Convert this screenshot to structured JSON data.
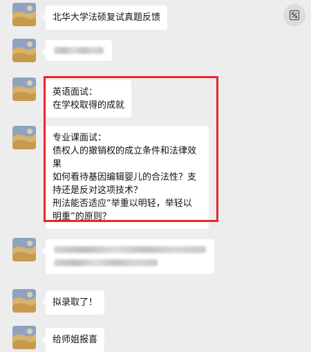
{
  "messages": {
    "m1": "北华大学法硕复试真题反馈",
    "m3": {
      "line1": "英语面试：",
      "line2": "在学校取得的成就"
    },
    "m4": {
      "line1": "专业课面试：",
      "line2": "债权人的撤销权的成立条件和法律效",
      "line3": "果",
      "line4": "如何看待基因编辑婴儿的合法性？支",
      "line5": "持还是反对这项技术？",
      "line6": "刑法能否适应“举重以明轻，举轻以",
      "line7": "明重”的原则？"
    },
    "m6": "拟录取了！",
    "m7": "给师姐报喜"
  },
  "colors": {
    "chat_background": "#ededed",
    "bubble": "#ffffff",
    "highlight": "#e8262d"
  },
  "icons": {
    "expand": "expand-icon",
    "avatar": "avatar-image"
  }
}
